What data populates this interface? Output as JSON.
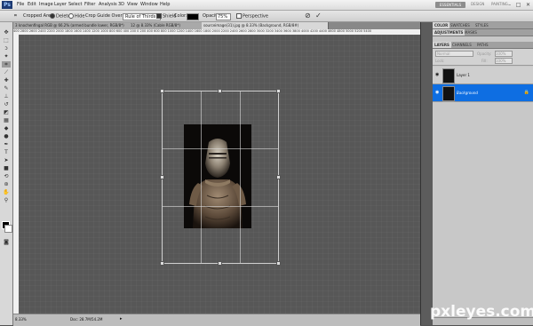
{
  "app": {
    "logo": "Ps"
  },
  "menu": [
    "File",
    "Edit",
    "Image",
    "Layer",
    "Select",
    "Filter",
    "Analysis",
    "3D",
    "View",
    "Window",
    "Help"
  ],
  "workspaces": {
    "active": "ESSENTIALS",
    "design": "DESIGN",
    "painting": "PAINTING"
  },
  "window_controls": [
    "–",
    "□",
    "✕"
  ],
  "options": {
    "cropped_area_label": "Cropped Area:",
    "delete_label": "Delete",
    "hide_label": "Hide",
    "overlay_label": "Crop Guide Overlay:",
    "overlay_value": "Rule of Thirds",
    "shield_label": "Shield",
    "color_label": "Color:",
    "opacity_label": "Opacity:",
    "opacity_value": "75%",
    "perspective_label": "Perspective"
  },
  "tabs": [
    {
      "label": "3 knochenfingal RGB @ 66.2% (armed bundle lower, RGB/8*)",
      "active": false
    },
    {
      "label": "12 @ 8.33% (Cable RGB/8*)",
      "active": false
    },
    {
      "label": "sourceimage(31).jpg @ 8.33% (Background, RGB/8#)",
      "active": true
    }
  ],
  "ruler_labels": "400 2800 2600 2400 2200 2000 1800 1600 1400 1200 1000 800 600 400 200 0 200 400 600 800 1000 1200 1400 1600 1800 2000 2200 2400 2600 2800 3000 3200 3400 3600 3800 4000 4200 4400 4600 4800 5000 5200 5400",
  "status": {
    "zoom": "8.33%",
    "doc": "Doc: 28.7M/54.2M"
  },
  "panels": {
    "top_tabs": [
      "COLOR",
      "SWATCHES",
      "STYLES"
    ],
    "adj_tabs": [
      "ADJUSTMENTS",
      "MASKS"
    ],
    "layer_tabs": [
      "LAYERS",
      "CHANNELS",
      "PATHS"
    ],
    "blend_mode": "Normal",
    "opacity_label": "Opacity:",
    "opacity_value": "100%",
    "lock_label": "Lock:",
    "fill_label": "Fill:",
    "fill_value": "100%"
  },
  "layers": [
    {
      "name": "Layer 1",
      "selected": false
    },
    {
      "name": "Background",
      "selected": true
    }
  ],
  "watermark": "pxleyes.com"
}
